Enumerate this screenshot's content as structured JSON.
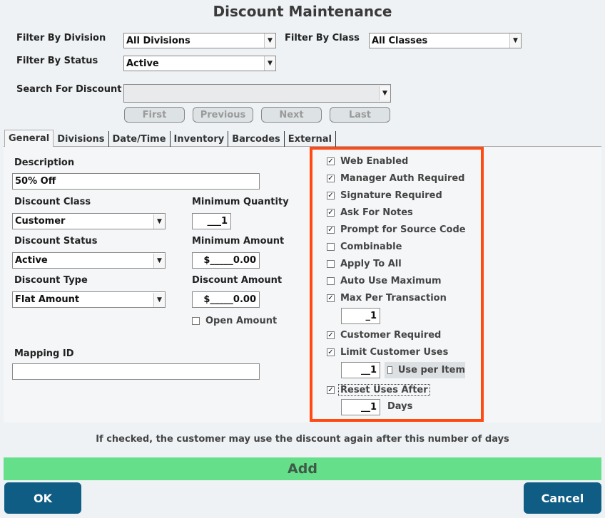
{
  "title": "Discount Maintenance",
  "filters": {
    "division_label": "Filter By Division",
    "division_value": "All Divisions",
    "class_label": "Filter By Class",
    "class_value": "All Classes",
    "status_label": "Filter By Status",
    "status_value": "Active",
    "search_label": "Search For Discount",
    "search_value": ""
  },
  "nav": {
    "first": "First",
    "previous": "Previous",
    "next": "Next",
    "last": "Last"
  },
  "tabs": [
    "General",
    "Divisions",
    "Date/Time",
    "Inventory",
    "Barcodes",
    "External"
  ],
  "form": {
    "description_label": "Description",
    "description_value": "50% Off",
    "class_label": "Discount Class",
    "class_value": "Customer",
    "status_label": "Discount Status",
    "status_value": "Active",
    "type_label": "Discount Type",
    "type_value": "Flat Amount",
    "min_qty_label": "Minimum Quantity",
    "min_qty_value": "___1",
    "min_amount_label": "Minimum Amount",
    "min_amount_value": "$_____0.00",
    "discount_amount_label": "Discount Amount",
    "discount_amount_value": "$_____0.00",
    "open_amount_label": "Open Amount",
    "mapping_label": "Mapping ID",
    "mapping_value": ""
  },
  "options": {
    "web_enabled": "Web Enabled",
    "manager_auth": "Manager Auth Required",
    "signature": "Signature Required",
    "ask_notes": "Ask For Notes",
    "prompt_source": "Prompt for Source Code",
    "combinable": "Combinable",
    "apply_all": "Apply To All",
    "auto_max": "Auto Use Maximum",
    "max_per_txn": "Max Per Transaction",
    "max_per_txn_value": "_1",
    "customer_required": "Customer Required",
    "limit_uses": "Limit Customer Uses",
    "limit_uses_value": "__1",
    "use_per_item": "Use per Item",
    "reset_after": "Reset Uses After",
    "reset_after_value": "__1",
    "days": "Days"
  },
  "check_mark": "✓",
  "hint": "If checked, the customer may use the discount again after this number of days",
  "buttons": {
    "add": "Add",
    "ok": "OK",
    "cancel": "Cancel"
  },
  "colors": {
    "highlight": "#ff4a14",
    "add_bar": "#66df8a",
    "button": "#0f5d84"
  }
}
